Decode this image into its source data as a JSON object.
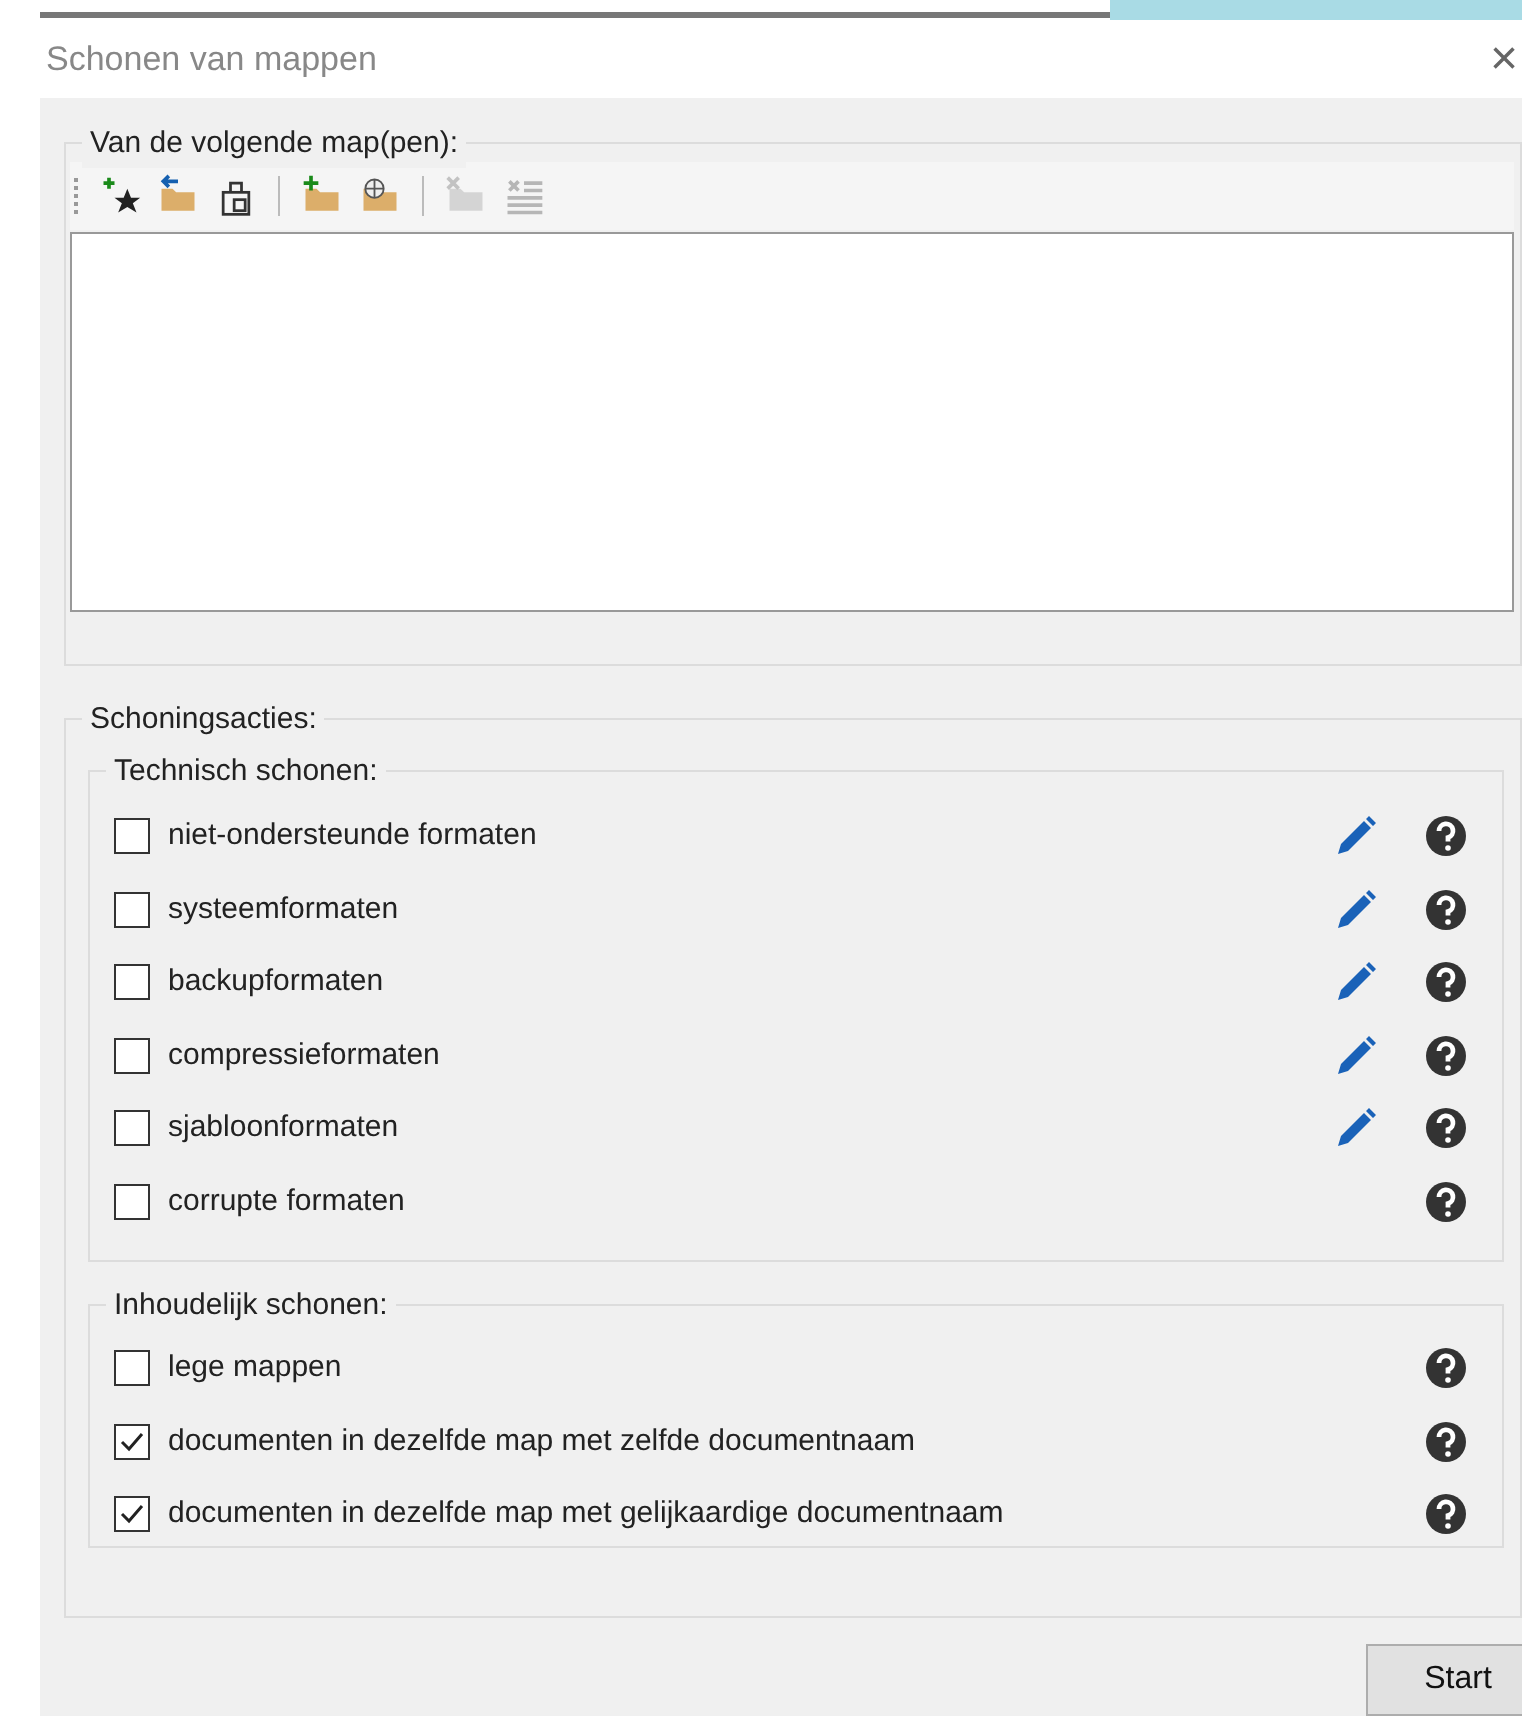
{
  "window": {
    "title": "Schonen van mappen",
    "close": "×"
  },
  "folders": {
    "label": "Van de volgende map(pen):",
    "toolbar": [
      {
        "kind": "add-favorite",
        "disabled": false
      },
      {
        "kind": "folder-back",
        "disabled": false
      },
      {
        "kind": "clipboard",
        "disabled": false
      },
      {
        "kind": "separator"
      },
      {
        "kind": "add-folder",
        "disabled": false
      },
      {
        "kind": "network-folder",
        "disabled": false
      },
      {
        "kind": "separator"
      },
      {
        "kind": "remove-folder",
        "disabled": true
      },
      {
        "kind": "list",
        "disabled": true
      }
    ]
  },
  "actions": {
    "label": "Schoningsacties:",
    "groups": [
      {
        "label": "Technisch schonen:",
        "items": [
          {
            "label": "niet-ondersteunde formaten",
            "checked": false,
            "editable": true
          },
          {
            "label": "systeemformaten",
            "checked": false,
            "editable": true
          },
          {
            "label": "backupformaten",
            "checked": false,
            "editable": true
          },
          {
            "label": "compressieformaten",
            "checked": false,
            "editable": true
          },
          {
            "label": "sjabloonformaten",
            "checked": false,
            "editable": true
          },
          {
            "label": "corrupte formaten",
            "checked": false,
            "editable": false
          }
        ]
      },
      {
        "label": "Inhoudelijk schonen:",
        "items": [
          {
            "label": "lege mappen",
            "checked": false,
            "editable": false
          },
          {
            "label": "documenten in dezelfde map met zelfde documentnaam",
            "checked": true,
            "editable": false
          },
          {
            "label": "documenten in dezelfde map met gelijkaardige documentnaam",
            "checked": true,
            "editable": false
          }
        ]
      }
    ]
  },
  "start_button": "Start"
}
